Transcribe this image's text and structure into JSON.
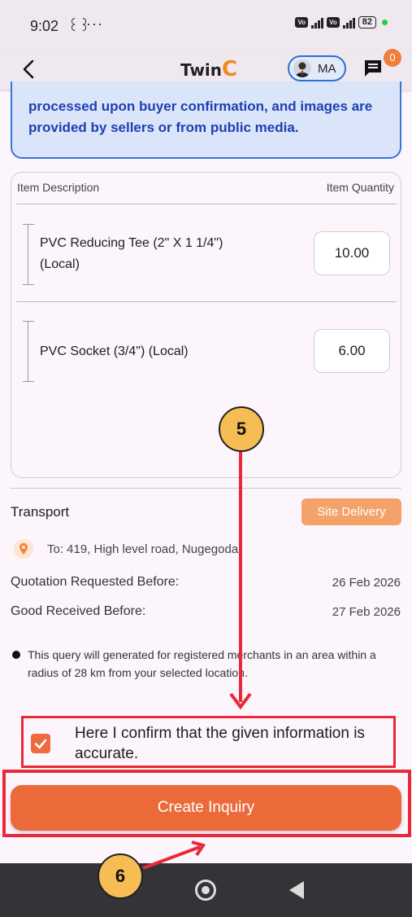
{
  "status_bar": {
    "time": "9:02",
    "extra_symbol": "꒰꒱",
    "dots": "···",
    "battery": "82"
  },
  "header": {
    "logo_text": "Twin",
    "logo_letter": "C",
    "user_initials": "MA",
    "notification_count": "0"
  },
  "info": {
    "text": "processed upon buyer confirmation, and images are provided by sellers or from public media."
  },
  "items": {
    "col_description": "Item Description",
    "col_quantity": "Item Quantity",
    "rows": [
      {
        "name": "PVC Reducing Tee (2\" X 1 1/4\") (Local)",
        "quantity": "10.00"
      },
      {
        "name": "PVC Socket (3/4\") (Local)",
        "quantity": "6.00"
      }
    ]
  },
  "transport": {
    "label": "Transport",
    "delivery_button": "Site Delivery",
    "address": "To: 419, High level road, Nugegoda"
  },
  "dates": {
    "quotation_label": "Quotation Requested Before:",
    "quotation_value": "26 Feb 2026",
    "received_label": "Good Received Before:",
    "received_value": "27 Feb 2026"
  },
  "note": "This query will generated for registered merchants in an area within a radius of 28 km from your selected location.",
  "confirm": {
    "text": "Here I confirm that the given information is accurate.",
    "checked": true
  },
  "create_button": "Create Inquiry",
  "annotations": {
    "step_5": "5",
    "step_6": "6"
  },
  "colors": {
    "accent": "#ec6a3a",
    "highlight": "#e8293a",
    "info_bg": "#dbe5f9",
    "info_text": "#1d3fb3",
    "annotation": "#f6bd55"
  }
}
